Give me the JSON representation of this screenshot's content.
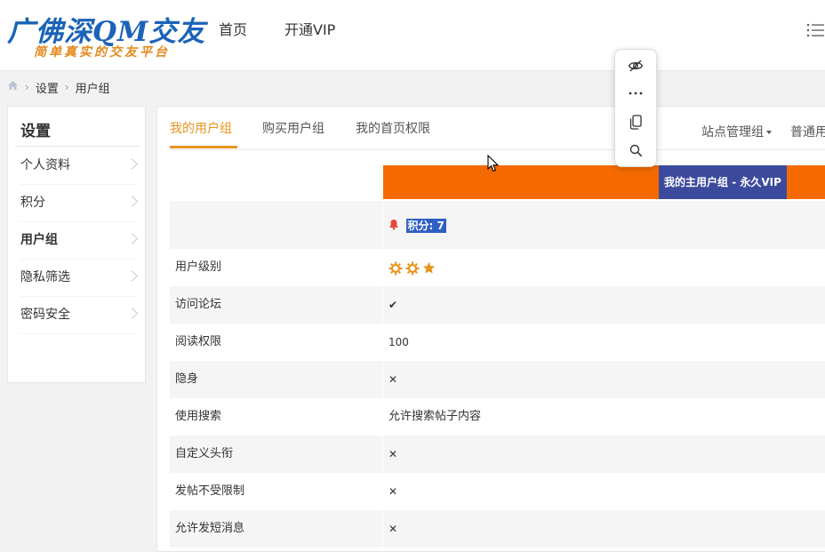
{
  "header": {
    "logo_text": "广佛深QM交友",
    "logo_slogan": "简单真实的交友平台",
    "nav": [
      "首页",
      "开通VIP"
    ]
  },
  "breadcrumb": [
    "设置",
    "用户组"
  ],
  "sidebar": {
    "title": "设置",
    "items": [
      {
        "label": "个人资料"
      },
      {
        "label": "积分"
      },
      {
        "label": "用户组"
      },
      {
        "label": "隐私筛选"
      },
      {
        "label": "密码安全"
      }
    ]
  },
  "tabs": {
    "items": [
      "我的用户组",
      "购买用户组",
      "我的首页权限"
    ],
    "admin_group": "站点管理组",
    "regular_group": "普通用"
  },
  "table": {
    "main_group_label": "我的主用户组 - 永久VIP",
    "points_label": "积分: 7",
    "rows": [
      {
        "label": "用户级别",
        "value": ""
      },
      {
        "label": "访问论坛",
        "value": "✔"
      },
      {
        "label": "阅读权限",
        "value": "100"
      },
      {
        "label": "隐身",
        "value": "✕"
      },
      {
        "label": "使用搜索",
        "value": "允许搜索帖子内容"
      },
      {
        "label": "自定义头衔",
        "value": "✕"
      },
      {
        "label": "发帖不受限制",
        "value": "✕"
      },
      {
        "label": "允许发短消息",
        "value": "✕"
      }
    ]
  },
  "colors": {
    "accent": "#e8951d",
    "orange_bar": "#f56a00",
    "vip_box": "#3b4a9c",
    "logo_blue": "#1b63b8"
  }
}
